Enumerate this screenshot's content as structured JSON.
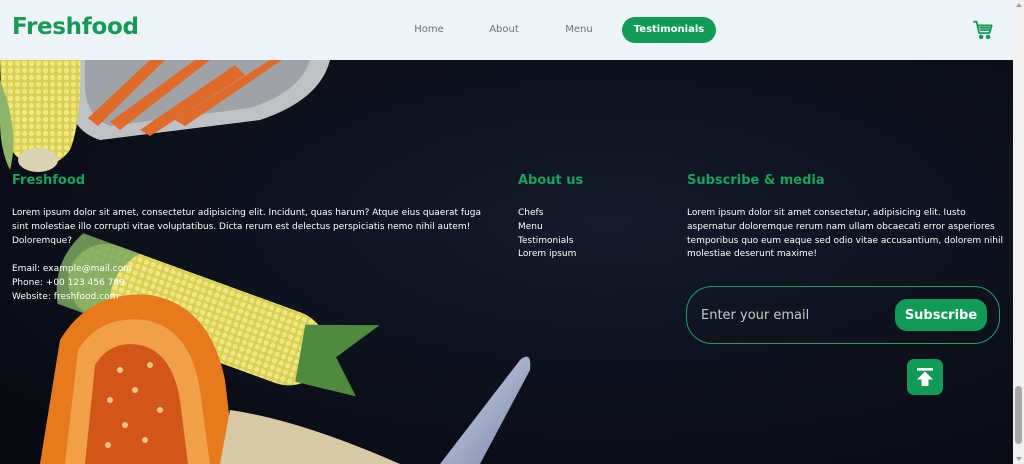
{
  "header": {
    "logo": "Freshfood",
    "nav": [
      {
        "label": "Home"
      },
      {
        "label": "About"
      },
      {
        "label": "Menu"
      },
      {
        "label": "Testimonials",
        "active": true
      }
    ],
    "cart_icon": "shopping-cart-icon"
  },
  "footer": {
    "brand": {
      "title": "Freshfood",
      "text": "Lorem ipsum dolor sit amet, consectetur adipisicing elit. Incidunt, quas harum? Atque eius quaerat fuga sint molestiae illo corrupti vitae voluptatibus. Dicta rerum est delectus perspiciatis nemo nihil autem! Doloremque?",
      "email": "Email: example@mail.com",
      "phone": "Phone: +00 123 456 789",
      "website": "Website: freshfood.com"
    },
    "about": {
      "title": "About us",
      "links": [
        "Chefs",
        "Menu",
        "Testimonials",
        "Lorem ipsum"
      ]
    },
    "subscribe": {
      "title": "Subscribe & media",
      "text": "Lorem ipsum dolor sit amet consectetur, adipisicing elit. Iusto aspernatur doloremque rerum nam ullam obcaecati error asperiores temporibus quo eum eaque sed odio vitae accusantium, dolorem nihil molestiae deserunt maxime!",
      "email_placeholder": "Enter your email",
      "button": "Subscribe"
    },
    "back_to_top_icon": "arrow-up-to-top-icon"
  },
  "colors": {
    "accent": "#129b57",
    "header_bg": "#eef3f8",
    "page_bg": "#0b0e18"
  }
}
